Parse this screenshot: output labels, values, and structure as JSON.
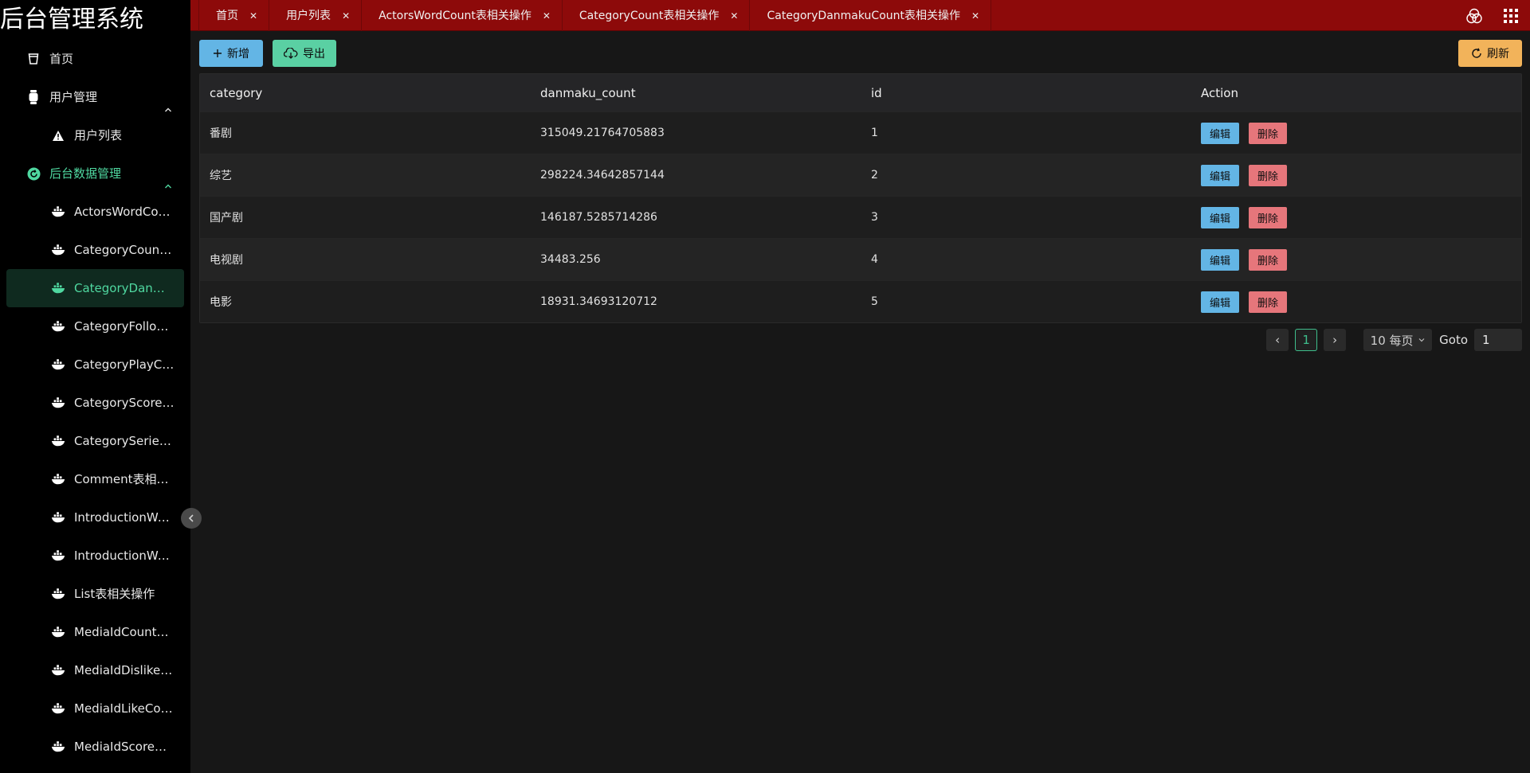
{
  "app": {
    "title": "后台管理系统"
  },
  "sidebar": {
    "items": [
      {
        "label": "首页",
        "level": 1,
        "icon": "cup-icon"
      },
      {
        "label": "用户管理",
        "level": 1,
        "icon": "watch-icon",
        "expanded": true
      },
      {
        "label": "用户列表",
        "level": 2,
        "icon": "warning-icon"
      },
      {
        "label": "后台数据管理",
        "level": 1,
        "icon": "refresh-circle-icon",
        "expanded": true,
        "highlighted": true
      },
      {
        "label": "ActorsWordCount表相关操作",
        "level": 2,
        "icon": "ship-icon"
      },
      {
        "label": "CategoryCount表相关操作",
        "level": 2,
        "icon": "ship-icon"
      },
      {
        "label": "CategoryDanmakuCount表相关操作",
        "level": 2,
        "icon": "ship-icon",
        "active": true
      },
      {
        "label": "CategoryFollowCount表相关操作",
        "level": 2,
        "icon": "ship-icon"
      },
      {
        "label": "CategoryPlayCount表相关操作",
        "level": 2,
        "icon": "ship-icon"
      },
      {
        "label": "CategoryScore表相关操作",
        "level": 2,
        "icon": "ship-icon"
      },
      {
        "label": "CategorySeriesFollowCount表相关操作",
        "level": 2,
        "icon": "ship-icon"
      },
      {
        "label": "Comment表相关操作",
        "level": 2,
        "icon": "ship-icon"
      },
      {
        "label": "IntroductionWordCount表相关操作",
        "level": 2,
        "icon": "ship-icon"
      },
      {
        "label": "IntroductionWordFreq表相关操作",
        "level": 2,
        "icon": "ship-icon"
      },
      {
        "label": "List表相关操作",
        "level": 2,
        "icon": "ship-icon"
      },
      {
        "label": "MediaIdCount表相关操作",
        "level": 2,
        "icon": "ship-icon"
      },
      {
        "label": "MediaIdDislikeCount表相关操作",
        "level": 2,
        "icon": "ship-icon"
      },
      {
        "label": "MediaIdLikeCount表相关操作",
        "level": 2,
        "icon": "ship-icon"
      },
      {
        "label": "MediaIdScore表相关操作",
        "level": 2,
        "icon": "ship-icon"
      }
    ]
  },
  "tabs": [
    {
      "label": "首页"
    },
    {
      "label": "用户列表"
    },
    {
      "label": "ActorsWordCount表相关操作"
    },
    {
      "label": "CategoryCount表相关操作"
    },
    {
      "label": "CategoryDanmakuCount表相关操作",
      "active": true
    }
  ],
  "topbar": {
    "icons": [
      "theme-circles-icon",
      "apps-grid-icon"
    ]
  },
  "toolbar": {
    "add_label": "新增",
    "export_label": "导出",
    "refresh_label": "刷新"
  },
  "table": {
    "columns": [
      "category",
      "danmaku_count",
      "id",
      "Action"
    ],
    "rows": [
      {
        "category": "番剧",
        "danmaku_count": "315049.21764705883",
        "id": "1"
      },
      {
        "category": "综艺",
        "danmaku_count": "298224.34642857144",
        "id": "2"
      },
      {
        "category": "国产剧",
        "danmaku_count": "146187.5285714286",
        "id": "3"
      },
      {
        "category": "电视剧",
        "danmaku_count": "34483.256",
        "id": "4"
      },
      {
        "category": "电影",
        "danmaku_count": "18931.34693120712",
        "id": "5"
      }
    ],
    "edit_label": "编辑",
    "delete_label": "删除"
  },
  "pagination": {
    "prev": "‹",
    "next": "›",
    "current_page": "1",
    "page_size": "10 每页",
    "goto_label": "Goto",
    "goto_value": "1"
  },
  "colors": {
    "topbar": "#8d0a0a",
    "sidebar": "#000000",
    "accent_green": "#4fd8a0",
    "btn_blue": "#63b5e5",
    "btn_green": "#5ad0a3",
    "btn_orange": "#f2b35a",
    "btn_red": "#e6767b"
  }
}
